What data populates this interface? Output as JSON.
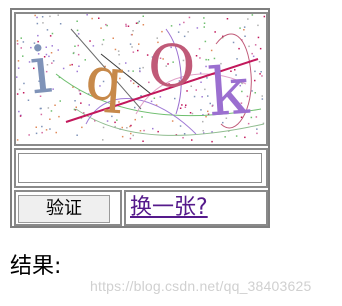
{
  "captcha": {
    "characters": [
      "i",
      "q",
      "O",
      "k"
    ],
    "char_colors": [
      "#7f93b8",
      "#c7894a",
      "#c05a78",
      "#9b6fd0"
    ],
    "noise_line_colors": [
      "#c2185b",
      "#6fbf6f",
      "#a07bd6",
      "#e0a0c8",
      "#8fbc8f"
    ]
  },
  "form": {
    "code_value": "",
    "verify_label": "验证",
    "refresh_link": "换一张?"
  },
  "result": {
    "label": "结果:"
  },
  "watermark": {
    "text": "https://blog.csdn.net/qq_38403625"
  }
}
